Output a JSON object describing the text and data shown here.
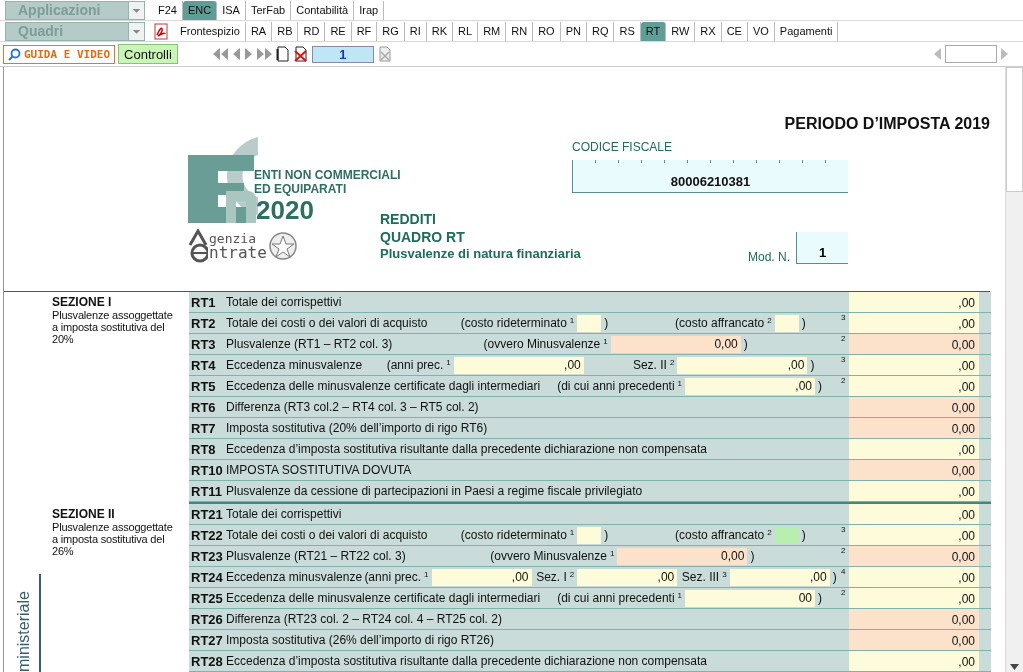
{
  "menus": [
    {
      "label": "Applicazioni",
      "tabs": [
        {
          "label": "F24",
          "selected": false
        },
        {
          "label": "ENC",
          "selected": true
        },
        {
          "label": "ISA",
          "selected": false
        },
        {
          "label": "TerFab",
          "selected": false
        },
        {
          "label": "Contabilità",
          "selected": false
        },
        {
          "label": "Irap",
          "selected": false
        }
      ]
    },
    {
      "label": "Quadri",
      "pdf": true,
      "tabs": [
        {
          "label": "Frontespizio",
          "selected": false
        },
        {
          "label": "RA",
          "selected": false
        },
        {
          "label": "RB",
          "selected": false
        },
        {
          "label": "RD",
          "selected": false
        },
        {
          "label": "RE",
          "selected": false
        },
        {
          "label": "RF",
          "selected": false
        },
        {
          "label": "RG",
          "selected": false
        },
        {
          "label": "RI",
          "selected": false
        },
        {
          "label": "RK",
          "selected": false
        },
        {
          "label": "RL",
          "selected": false
        },
        {
          "label": "RM",
          "selected": false
        },
        {
          "label": "RN",
          "selected": false
        },
        {
          "label": "RO",
          "selected": false
        },
        {
          "label": "PN",
          "selected": false
        },
        {
          "label": "RQ",
          "selected": false
        },
        {
          "label": "RS",
          "selected": false
        },
        {
          "label": "RT",
          "selected": true
        },
        {
          "label": "RW",
          "selected": false
        },
        {
          "label": "RX",
          "selected": false
        },
        {
          "label": "CE",
          "selected": false
        },
        {
          "label": "VO",
          "selected": false
        },
        {
          "label": "Pagamenti",
          "selected": false
        }
      ]
    }
  ],
  "toolbar": {
    "guide_button": "GUIDA E VIDEO",
    "checks_button": "Controlli",
    "page": "1"
  },
  "header": {
    "period": "PERIODO D’IMPOSTA 2019",
    "logo": {
      "lines": [
        "ENTI NON COMMERCIALI",
        "ED EQUIPARATI"
      ],
      "year": "2020",
      "agency": [
        "genzia",
        "ntrate"
      ]
    },
    "titles": [
      "REDDITI",
      "QUADRO RT"
    ],
    "subtitle": "Plusvalenze di natura finanziaria",
    "tax_code": {
      "label": "CODICE FISCALE",
      "value": "80006210381"
    },
    "module": {
      "label": "Mod. N.",
      "value": "1"
    }
  },
  "sections": [
    {
      "title": "SEZIONE I",
      "description": "Plusvalenze assoggettate a imposta sostitutiva del 20%",
      "rows": [
        {
          "code": "RT1",
          "label": "Totale dei corrispettivi",
          "total": {
            "value": ",00",
            "color": "#fdfbd9"
          }
        },
        {
          "code": "RT2",
          "label": "Totale dei costi o dei valori di acquisto",
          "groups": [
            [
              {
                "kind": "text",
                "text": "(costo rideterminato"
              },
              {
                "kind": "field",
                "num": "1",
                "color": "#fdfbd9"
              },
              {
                "kind": "text",
                "text": ")"
              }
            ],
            [
              {
                "kind": "text",
                "text": "(costo affrancato"
              },
              {
                "kind": "field",
                "num": "2",
                "color": "#fdfbd9"
              },
              {
                "kind": "text",
                "text": ")"
              }
            ]
          ],
          "total": {
            "num": "3",
            "value": ",00",
            "color": "#fdfbd9"
          }
        },
        {
          "code": "RT3",
          "label": "Plusvalenze (RT1 – RT2 col. 3)",
          "groups": [
            [
              {
                "kind": "text",
                "text": "(ovvero Minusvalenze"
              },
              {
                "kind": "field",
                "num": "1",
                "value": "0,00",
                "color": "#fde2cb"
              },
              {
                "kind": "text",
                "text": ")"
              }
            ]
          ],
          "total": {
            "num": "2",
            "value": "0,00",
            "color": "#fde2cb"
          }
        },
        {
          "code": "RT4",
          "label": "Eccedenza minusvalenze",
          "groups": [
            [
              {
                "kind": "text",
                "text": "(anni prec."
              },
              {
                "kind": "field",
                "num": "1",
                "value": ",00",
                "color": "#fdfbd9"
              }
            ],
            [
              {
                "kind": "text",
                "text": "Sez. II"
              },
              {
                "kind": "field",
                "num": "2",
                "value": ",00",
                "color": "#fdfbd9"
              },
              {
                "kind": "text",
                "text": ")"
              }
            ]
          ],
          "total": {
            "num": "3",
            "value": ",00",
            "color": "#fdfbd9"
          }
        },
        {
          "code": "RT5",
          "label": "Eccedenza delle minusvalenze certificate dagli intermediari",
          "groups": [
            [
              {
                "kind": "text",
                "text": "(di cui anni precedenti"
              },
              {
                "kind": "field",
                "num": "1",
                "value": ",00",
                "color": "#fdfbd9"
              },
              {
                "kind": "text",
                "text": ")"
              }
            ]
          ],
          "total": {
            "num": "2",
            "value": ",00",
            "color": "#fdfbd9"
          }
        },
        {
          "code": "RT6",
          "label": "Differenza (RT3 col.2 – RT4 col. 3 – RT5 col. 2)",
          "total": {
            "value": "0,00",
            "color": "#fde2cb"
          }
        },
        {
          "code": "RT7",
          "label": "Imposta sostitutiva (20% dell’importo di rigo RT6)",
          "total": {
            "value": "0,00",
            "color": "#fde2cb"
          }
        },
        {
          "code": "RT8",
          "label": "Eccedenza d’imposta sostitutiva risultante dalla precedente dichiarazione non compensata",
          "total": {
            "value": ",00",
            "color": "#fdfbd9"
          }
        },
        {
          "code": "RT10",
          "label": "IMPOSTA SOSTITUTIVA DOVUTA",
          "total": {
            "value": "0,00",
            "color": "#fde2cb"
          }
        },
        {
          "code": "RT11",
          "label": "Plusvalenze da cessione di partecipazioni in Paesi a regime fiscale privilegiato",
          "total": {
            "value": ",00",
            "color": "#fdfbd9"
          }
        }
      ]
    },
    {
      "title": "SEZIONE II",
      "description": "Plusvalenze assoggettate a imposta sostitutiva del 26%",
      "side_label": "ministeriale",
      "rows": [
        {
          "code": "RT21",
          "label": "Totale dei corrispettivi",
          "total": {
            "value": ",00",
            "color": "#fdfbd9"
          }
        },
        {
          "code": "RT22",
          "label": "Totale dei costi o dei valori di acquisto",
          "groups": [
            [
              {
                "kind": "text",
                "text": "(costo rideterminato"
              },
              {
                "kind": "field",
                "num": "1",
                "color": "#fdfbd9"
              },
              {
                "kind": "text",
                "text": ")"
              }
            ],
            [
              {
                "kind": "text",
                "text": "(costo affrancato"
              },
              {
                "kind": "field",
                "num": "2",
                "color": "#b8eeae"
              },
              {
                "kind": "text",
                "text": ")"
              }
            ]
          ],
          "total": {
            "num": "3",
            "value": ",00",
            "color": "#fdfbd9"
          }
        },
        {
          "code": "RT23",
          "label": "Plusvalenze (RT21 – RT22 col. 3)",
          "groups": [
            [
              {
                "kind": "text",
                "text": "(ovvero Minusvalenze"
              },
              {
                "kind": "field",
                "num": "1",
                "value": "0,00",
                "color": "#fde2cb"
              },
              {
                "kind": "text",
                "text": ")"
              }
            ]
          ],
          "total": {
            "num": "2",
            "value": "0,00",
            "color": "#fde2cb"
          }
        },
        {
          "code": "RT24",
          "label": "Eccedenza minusvalenze",
          "groups": [
            [
              {
                "kind": "text",
                "text": "(anni prec."
              },
              {
                "kind": "field",
                "num": "1",
                "value": ",00",
                "color": "#fdfbd9"
              }
            ],
            [
              {
                "kind": "text",
                "text": "Sez. I"
              },
              {
                "kind": "field",
                "num": "2",
                "value": ",00",
                "color": "#fdfbd9"
              }
            ],
            [
              {
                "kind": "text",
                "text": "Sez. III"
              },
              {
                "kind": "field",
                "num": "3",
                "value": ",00",
                "color": "#fdfbd9"
              },
              {
                "kind": "text",
                "text": ")"
              }
            ]
          ],
          "total": {
            "num": "4",
            "value": ",00",
            "color": "#fdfbd9"
          }
        },
        {
          "code": "RT25",
          "label": "Eccedenza delle minusvalenze certificate dagli intermediari",
          "groups": [
            [
              {
                "kind": "text",
                "text": "(di cui anni precedenti"
              },
              {
                "kind": "field",
                "num": "1",
                "value": "00",
                "color": "#fdfbd9"
              },
              {
                "kind": "text",
                "text": ")"
              }
            ]
          ],
          "total": {
            "num": "2",
            "value": ",00",
            "color": "#fdfbd9"
          }
        },
        {
          "code": "RT26",
          "label": "Differenza (RT23 col. 2 – RT24 col. 4 – RT25 col. 2)",
          "total": {
            "value": "0,00",
            "color": "#fde2cb"
          }
        },
        {
          "code": "RT27",
          "label": "Imposta sostitutiva (26% dell’importo di rigo RT26)",
          "total": {
            "value": "0,00",
            "color": "#fde2cb"
          }
        },
        {
          "code": "RT28",
          "label": "Eccedenza d’imposta sostitutiva risultante dalla precedente dichiarazione non compensata",
          "total": {
            "value": ",00",
            "color": "#fdfbd9"
          }
        }
      ]
    }
  ]
}
